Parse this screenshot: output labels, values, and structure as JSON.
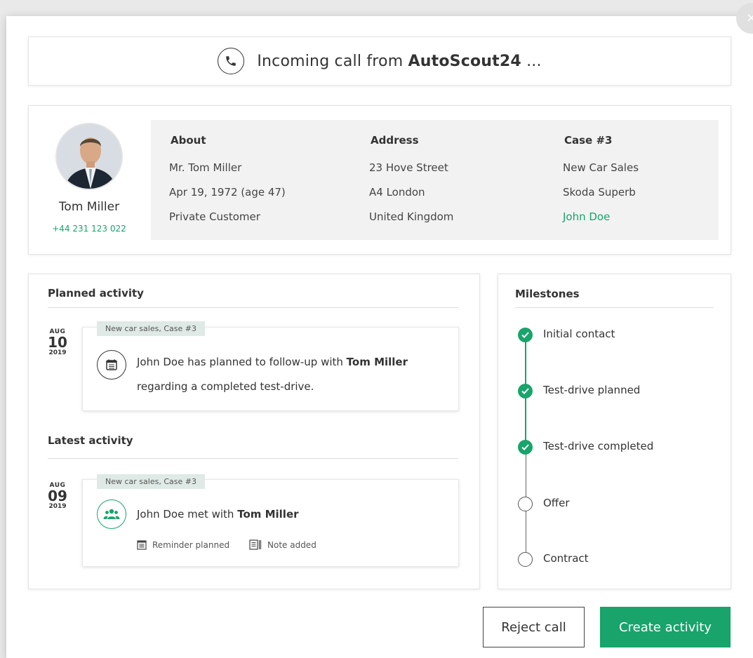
{
  "call": {
    "prefix": "Incoming call from ",
    "caller": "AutoScout24",
    "suffix": " ..."
  },
  "close_icon": "×",
  "customer": {
    "name": "Tom Miller",
    "phone": "+44 231 123 022",
    "about": {
      "title": "About",
      "lines": [
        "Mr. Tom Miller",
        "Apr 19, 1972 (age 47)",
        "Private Customer"
      ]
    },
    "address": {
      "title": "Address",
      "lines": [
        "23 Hove Street",
        "A4 London",
        "United Kingdom"
      ]
    },
    "case": {
      "title": "Case #3",
      "lines": [
        "New Car Sales",
        "Skoda Superb",
        "John Doe"
      ],
      "link_color": "#18a46b"
    }
  },
  "planned": {
    "title": "Planned activity",
    "date": {
      "month": "AUG",
      "day": "10",
      "year": "2019"
    },
    "tag": "New car sales, Case #3",
    "icon": "calendar-icon",
    "text_a": "John Doe has planned to follow-up with ",
    "text_bold": "Tom Miller",
    "text_b": "regarding a completed test-drive."
  },
  "latest": {
    "title": "Latest activity",
    "date": {
      "month": "AUG",
      "day": "09",
      "year": "2019"
    },
    "tag": "New car sales, Case #3",
    "icon": "group-icon",
    "text_a": "John Doe met with ",
    "text_bold": "Tom Miller",
    "sub": [
      "Reminder planned",
      "Note added"
    ]
  },
  "milestones": {
    "title": "Milestones",
    "items": [
      {
        "label": "Initial contact",
        "done": true
      },
      {
        "label": "Test-drive planned",
        "done": true
      },
      {
        "label": "Test-drive completed",
        "done": true
      },
      {
        "label": "Offer",
        "done": false
      },
      {
        "label": "Contract",
        "done": false
      }
    ]
  },
  "buttons": {
    "reject": "Reject call",
    "create": "Create activity"
  },
  "colors": {
    "accent": "#18a46b",
    "tag_bg": "#dfeae7",
    "info_bg": "#f2f2f2"
  }
}
